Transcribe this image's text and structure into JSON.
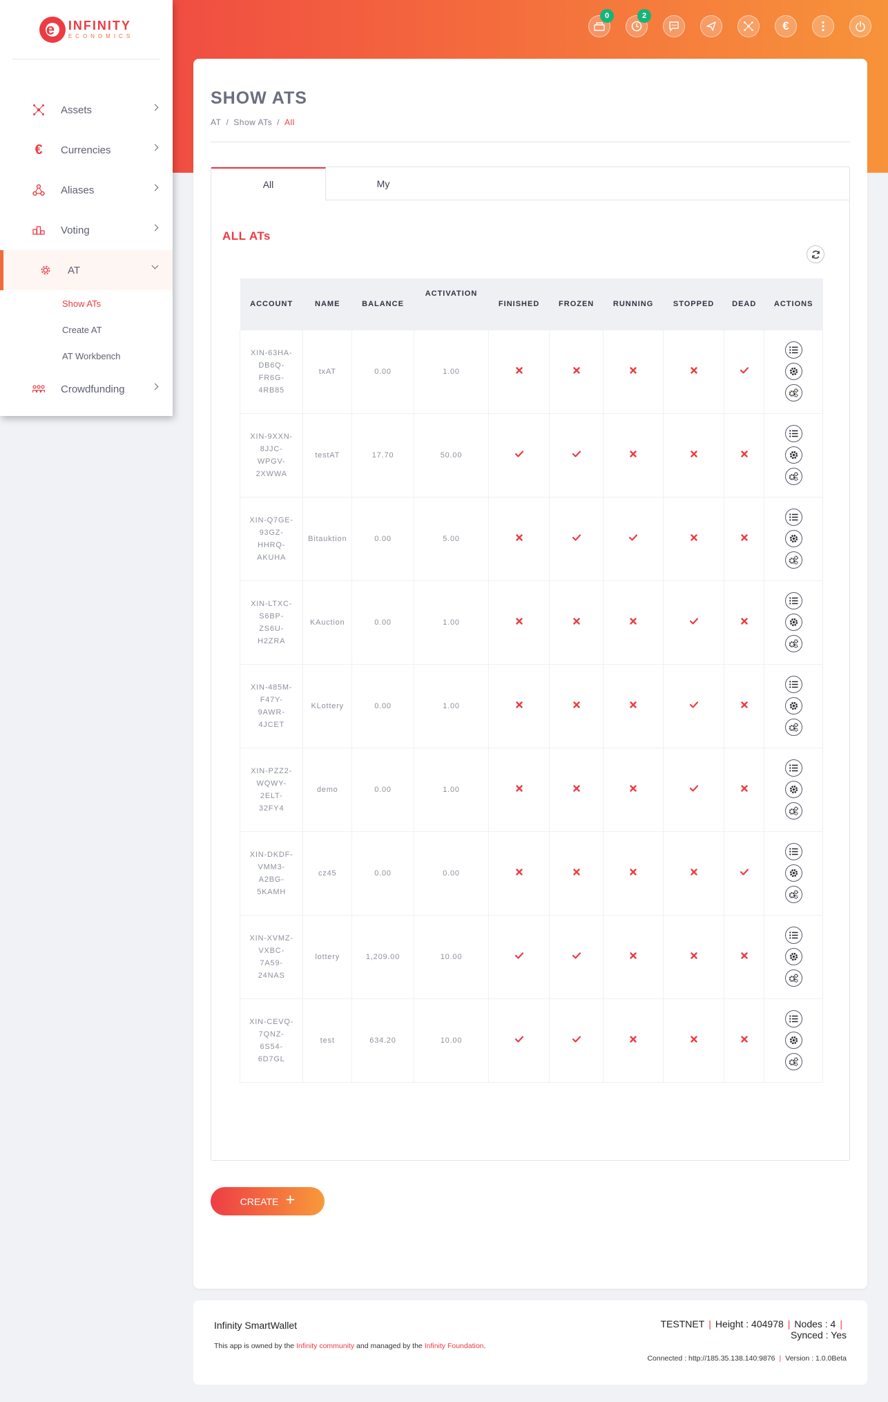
{
  "brand": {
    "logo_main": "INFINITY",
    "logo_sub": "ECONOMICS"
  },
  "colors": {
    "accent": "#ec3b42",
    "gradient_start": "#ee3d45",
    "gradient_end": "#f7933a",
    "badge": "#17b47a"
  },
  "sidebar": {
    "items": [
      {
        "label": "Assets",
        "icon": "assets-icon"
      },
      {
        "label": "Currencies",
        "icon": "euro-icon"
      },
      {
        "label": "Aliases",
        "icon": "aliases-icon"
      },
      {
        "label": "Voting",
        "icon": "voting-icon"
      },
      {
        "label": "AT",
        "icon": "gear-icon",
        "active": true
      },
      {
        "label": "Crowdfunding",
        "icon": "crowdfunding-icon"
      }
    ],
    "submenu": [
      {
        "label": "Show ATs",
        "active": true
      },
      {
        "label": "Create AT"
      },
      {
        "label": "AT Workbench"
      }
    ]
  },
  "topbar": {
    "icons": [
      {
        "name": "messages-bundle-icon",
        "badge": "0"
      },
      {
        "name": "clock-icon",
        "badge": "2"
      },
      {
        "name": "chat-icon"
      },
      {
        "name": "send-icon"
      },
      {
        "name": "network-icon"
      },
      {
        "name": "euro-icon"
      },
      {
        "name": "more-vertical-icon"
      },
      {
        "name": "power-icon"
      }
    ]
  },
  "page": {
    "title": "SHOW ATS",
    "breadcrumb": [
      "AT",
      "Show ATs",
      "All"
    ]
  },
  "tabs": [
    "All",
    "My"
  ],
  "section_title": "ALL ATs",
  "table": {
    "headers": [
      "ACCOUNT",
      "NAME",
      "BALANCE",
      "ACTIVATION",
      "FINISHED",
      "FROZEN",
      "RUNNING",
      "STOPPED",
      "DEAD",
      "ACTIONS"
    ],
    "rows": [
      {
        "account": [
          "XIN-63HA-",
          "DB6Q-",
          "FR6G-",
          "4RB85"
        ],
        "name": "txAT",
        "balance": "0.00",
        "activation": "1.00",
        "finished": false,
        "frozen": false,
        "running": false,
        "stopped": false,
        "dead": true
      },
      {
        "account": [
          "XIN-9XXN-",
          "8JJC-",
          "WPGV-",
          "2XWWA"
        ],
        "name": "testAT",
        "balance": "17.70",
        "activation": "50.00",
        "finished": true,
        "frozen": true,
        "running": false,
        "stopped": false,
        "dead": false
      },
      {
        "account": [
          "XIN-Q7GE-",
          "93GZ-",
          "HHRQ-",
          "AKUHA"
        ],
        "name": "Bitauktion",
        "balance": "0.00",
        "activation": "5.00",
        "finished": false,
        "frozen": true,
        "running": true,
        "stopped": false,
        "dead": false
      },
      {
        "account": [
          "XIN-LTXC-",
          "S6BP-",
          "ZS6U-",
          "H2ZRA"
        ],
        "name": "KAuction",
        "balance": "0.00",
        "activation": "1.00",
        "finished": false,
        "frozen": false,
        "running": false,
        "stopped": true,
        "dead": false
      },
      {
        "account": [
          "XIN-485M-",
          "F47Y-",
          "9AWR-",
          "4JCET"
        ],
        "name": "KLottery",
        "balance": "0.00",
        "activation": "1.00",
        "finished": false,
        "frozen": false,
        "running": false,
        "stopped": true,
        "dead": false
      },
      {
        "account": [
          "XIN-PZZ2-",
          "WQWY-",
          "2ELT-",
          "32FY4"
        ],
        "name": "demo",
        "balance": "0.00",
        "activation": "1.00",
        "finished": false,
        "frozen": false,
        "running": false,
        "stopped": true,
        "dead": false
      },
      {
        "account": [
          "XIN-DKDF-",
          "VMM3-",
          "A2BG-",
          "5KAMH"
        ],
        "name": "cz45",
        "balance": "0.00",
        "activation": "0.00",
        "finished": false,
        "frozen": false,
        "running": false,
        "stopped": false,
        "dead": true
      },
      {
        "account": [
          "XIN-XVMZ-",
          "VXBC-",
          "7A59-",
          "24NAS"
        ],
        "name": "lottery",
        "balance": "1,209.00",
        "activation": "10.00",
        "finished": true,
        "frozen": true,
        "running": false,
        "stopped": false,
        "dead": false
      },
      {
        "account": [
          "XIN-CEVQ-",
          "7QNZ-",
          "6S54-",
          "6D7GL"
        ],
        "name": "test",
        "balance": "634.20",
        "activation": "10.00",
        "finished": true,
        "frozen": true,
        "running": false,
        "stopped": false,
        "dead": false
      }
    ]
  },
  "create_button": "CREATE",
  "footer": {
    "brand": "Infinity SmartWallet",
    "note_pre": "This app is owned by the ",
    "note_link1": "Infinity community",
    "note_mid": " and managed by the ",
    "note_link2": "Infinity Foundation",
    "note_post": ".",
    "network": "TESTNET",
    "height": "Height : 404978",
    "nodes": "Nodes : 4",
    "synced": "Synced : Yes",
    "connected": "Connected : http://185.35.138.140:9876",
    "version": "Version : 1.0.0Beta"
  }
}
